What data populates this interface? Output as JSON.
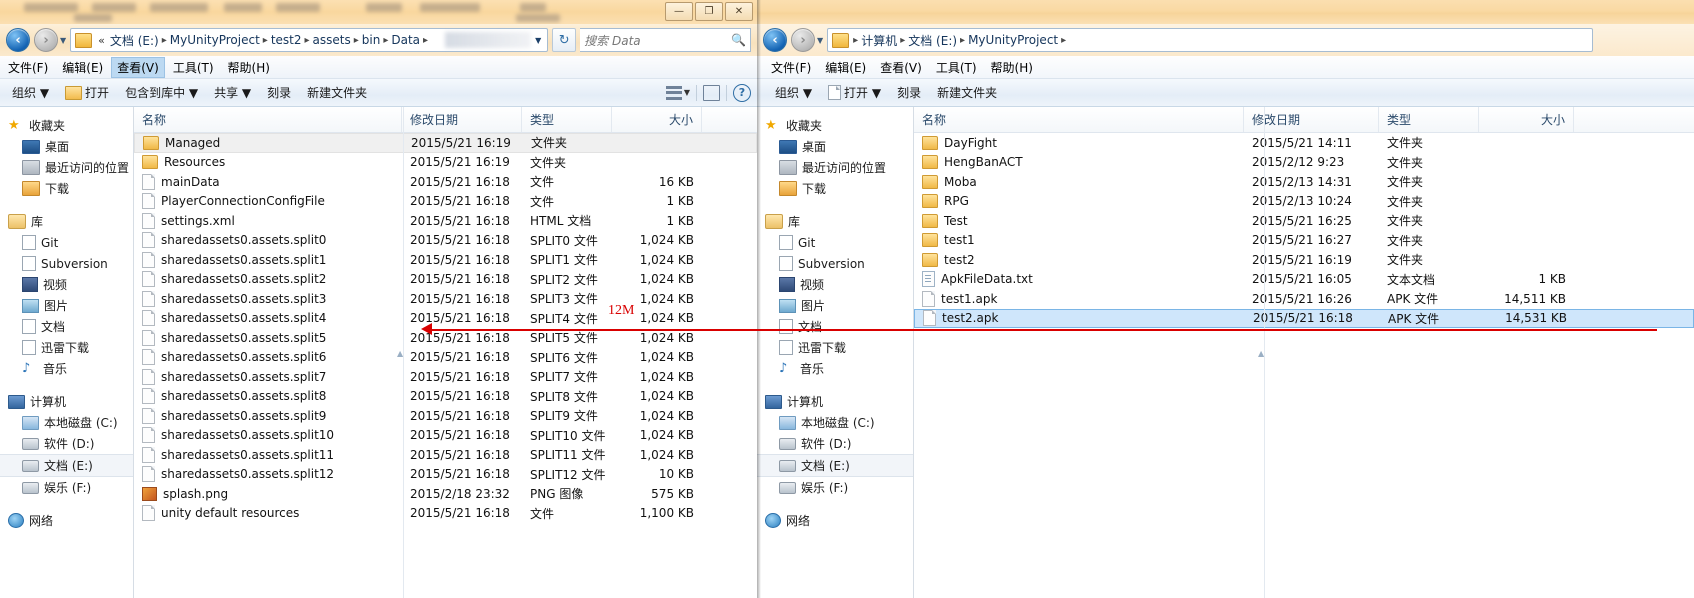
{
  "left_window": {
    "title_bar": {
      "minimize": "—",
      "maximize": "❐",
      "close": "✕"
    },
    "address": {
      "crumb_prefix": "«",
      "crumbs": [
        "文档 (E:)",
        "MyUnityProject",
        "test2",
        "assets",
        "bin",
        "Data"
      ],
      "separator": "▸",
      "dropdown": "▼",
      "refresh": "↻"
    },
    "search": {
      "placeholder": "搜索 Data",
      "icon": "search-icon"
    },
    "menu": [
      {
        "label": "文件(F)",
        "active": false
      },
      {
        "label": "编辑(E)",
        "active": false
      },
      {
        "label": "查看(V)",
        "active": true
      },
      {
        "label": "工具(T)",
        "active": false
      },
      {
        "label": "帮助(H)",
        "active": false
      }
    ],
    "commands": [
      {
        "label": "组织 ▼",
        "icon": "none"
      },
      {
        "label": "打开",
        "icon": "folder-icon"
      },
      {
        "label": "包含到库中 ▼",
        "icon": "none"
      },
      {
        "label": "共享 ▼",
        "icon": "none"
      },
      {
        "label": "刻录",
        "icon": "none"
      },
      {
        "label": "新建文件夹",
        "icon": "none"
      }
    ],
    "command_right": {
      "view_caret": "▼",
      "help": "?"
    },
    "nav_pane": [
      {
        "label": "收藏夹",
        "icon": "star-icon",
        "level": 0
      },
      {
        "label": "桌面",
        "icon": "desktop-icon",
        "level": 1
      },
      {
        "label": "最近访问的位置",
        "icon": "recent-icon",
        "level": 1
      },
      {
        "label": "下载",
        "icon": "download-icon",
        "level": 1
      },
      {
        "label": "__SPACE__",
        "icon": "",
        "level": 0
      },
      {
        "label": "库",
        "icon": "library-icon",
        "level": 0
      },
      {
        "label": "Git",
        "icon": "doc-icon",
        "level": 1
      },
      {
        "label": "Subversion",
        "icon": "doc-icon",
        "level": 1
      },
      {
        "label": "视频",
        "icon": "video-icon",
        "level": 1
      },
      {
        "label": "图片",
        "icon": "picture-icon",
        "level": 1
      },
      {
        "label": "文档",
        "icon": "doc-icon",
        "level": 1
      },
      {
        "label": "迅雷下载",
        "icon": "doc-icon",
        "level": 1
      },
      {
        "label": "音乐",
        "icon": "music-icon",
        "level": 1
      },
      {
        "label": "__SPACE__",
        "icon": "",
        "level": 0
      },
      {
        "label": "计算机",
        "icon": "computer-icon",
        "level": 0
      },
      {
        "label": "本地磁盘 (C:)",
        "icon": "hdd-c-icon",
        "level": 1
      },
      {
        "label": "软件 (D:)",
        "icon": "hdd-icon",
        "level": 1
      },
      {
        "label": "文档 (E:)",
        "icon": "hdd-icon",
        "level": 1,
        "selected": true
      },
      {
        "label": "娱乐 (F:)",
        "icon": "hdd-icon",
        "level": 1
      },
      {
        "label": "__SPACE__",
        "icon": "",
        "level": 0
      },
      {
        "label": "网络",
        "icon": "network-icon",
        "level": 0
      }
    ],
    "columns": [
      "名称",
      "修改日期",
      "类型",
      "大小"
    ],
    "files": [
      {
        "name": "Managed",
        "date": "2015/5/21 16:19",
        "type": "文件夹",
        "size": "",
        "icon": "folder",
        "selected_soft": true
      },
      {
        "name": "Resources",
        "date": "2015/5/21 16:19",
        "type": "文件夹",
        "size": "",
        "icon": "folder"
      },
      {
        "name": "mainData",
        "date": "2015/5/21 16:18",
        "type": "文件",
        "size": "16 KB",
        "icon": "file"
      },
      {
        "name": "PlayerConnectionConfigFile",
        "date": "2015/5/21 16:18",
        "type": "文件",
        "size": "1 KB",
        "icon": "file"
      },
      {
        "name": "settings.xml",
        "date": "2015/5/21 16:18",
        "type": "HTML 文档",
        "size": "1 KB",
        "icon": "file"
      },
      {
        "name": "sharedassets0.assets.split0",
        "date": "2015/5/21 16:18",
        "type": "SPLIT0 文件",
        "size": "1,024 KB",
        "icon": "file"
      },
      {
        "name": "sharedassets0.assets.split1",
        "date": "2015/5/21 16:18",
        "type": "SPLIT1 文件",
        "size": "1,024 KB",
        "icon": "file"
      },
      {
        "name": "sharedassets0.assets.split2",
        "date": "2015/5/21 16:18",
        "type": "SPLIT2 文件",
        "size": "1,024 KB",
        "icon": "file"
      },
      {
        "name": "sharedassets0.assets.split3",
        "date": "2015/5/21 16:18",
        "type": "SPLIT3 文件",
        "size": "1,024 KB",
        "icon": "file"
      },
      {
        "name": "sharedassets0.assets.split4",
        "date": "2015/5/21 16:18",
        "type": "SPLIT4 文件",
        "size": "1,024 KB",
        "icon": "file"
      },
      {
        "name": "sharedassets0.assets.split5",
        "date": "2015/5/21 16:18",
        "type": "SPLIT5 文件",
        "size": "1,024 KB",
        "icon": "file"
      },
      {
        "name": "sharedassets0.assets.split6",
        "date": "2015/5/21 16:18",
        "type": "SPLIT6 文件",
        "size": "1,024 KB",
        "icon": "file"
      },
      {
        "name": "sharedassets0.assets.split7",
        "date": "2015/5/21 16:18",
        "type": "SPLIT7 文件",
        "size": "1,024 KB",
        "icon": "file"
      },
      {
        "name": "sharedassets0.assets.split8",
        "date": "2015/5/21 16:18",
        "type": "SPLIT8 文件",
        "size": "1,024 KB",
        "icon": "file"
      },
      {
        "name": "sharedassets0.assets.split9",
        "date": "2015/5/21 16:18",
        "type": "SPLIT9 文件",
        "size": "1,024 KB",
        "icon": "file"
      },
      {
        "name": "sharedassets0.assets.split10",
        "date": "2015/5/21 16:18",
        "type": "SPLIT10 文件",
        "size": "1,024 KB",
        "icon": "file"
      },
      {
        "name": "sharedassets0.assets.split11",
        "date": "2015/5/21 16:18",
        "type": "SPLIT11 文件",
        "size": "1,024 KB",
        "icon": "file"
      },
      {
        "name": "sharedassets0.assets.split12",
        "date": "2015/5/21 16:18",
        "type": "SPLIT12 文件",
        "size": "10 KB",
        "icon": "file"
      },
      {
        "name": "splash.png",
        "date": "2015/2/18 23:32",
        "type": "PNG 图像",
        "size": "575 KB",
        "icon": "png"
      },
      {
        "name": "unity default resources",
        "date": "2015/5/21 16:18",
        "type": "文件",
        "size": "1,100 KB",
        "icon": "file"
      }
    ]
  },
  "right_window": {
    "address": {
      "crumbs": [
        "计算机",
        "文档 (E:)",
        "MyUnityProject"
      ],
      "separator": "▸"
    },
    "menu": [
      {
        "label": "文件(F)"
      },
      {
        "label": "编辑(E)"
      },
      {
        "label": "查看(V)"
      },
      {
        "label": "工具(T)"
      },
      {
        "label": "帮助(H)"
      }
    ],
    "commands": [
      {
        "label": "组织 ▼",
        "icon": "none"
      },
      {
        "label": "打开 ▼",
        "icon": "file-icon"
      },
      {
        "label": "刻录",
        "icon": "none"
      },
      {
        "label": "新建文件夹",
        "icon": "none"
      }
    ],
    "nav_pane": [
      {
        "label": "收藏夹",
        "icon": "star-icon",
        "level": 0
      },
      {
        "label": "桌面",
        "icon": "desktop-icon",
        "level": 1
      },
      {
        "label": "最近访问的位置",
        "icon": "recent-icon",
        "level": 1
      },
      {
        "label": "下载",
        "icon": "download-icon",
        "level": 1
      },
      {
        "label": "__SPACE__",
        "icon": "",
        "level": 0
      },
      {
        "label": "库",
        "icon": "library-icon",
        "level": 0
      },
      {
        "label": "Git",
        "icon": "doc-icon",
        "level": 1
      },
      {
        "label": "Subversion",
        "icon": "doc-icon",
        "level": 1
      },
      {
        "label": "视频",
        "icon": "video-icon",
        "level": 1
      },
      {
        "label": "图片",
        "icon": "picture-icon",
        "level": 1
      },
      {
        "label": "文档",
        "icon": "doc-icon",
        "level": 1
      },
      {
        "label": "迅雷下载",
        "icon": "doc-icon",
        "level": 1
      },
      {
        "label": "音乐",
        "icon": "music-icon",
        "level": 1
      },
      {
        "label": "__SPACE__",
        "icon": "",
        "level": 0
      },
      {
        "label": "计算机",
        "icon": "computer-icon",
        "level": 0
      },
      {
        "label": "本地磁盘 (C:)",
        "icon": "hdd-c-icon",
        "level": 1
      },
      {
        "label": "软件 (D:)",
        "icon": "hdd-icon",
        "level": 1
      },
      {
        "label": "文档 (E:)",
        "icon": "hdd-icon",
        "level": 1,
        "selected": true
      },
      {
        "label": "娱乐 (F:)",
        "icon": "hdd-icon",
        "level": 1
      },
      {
        "label": "__SPACE__",
        "icon": "",
        "level": 0
      },
      {
        "label": "网络",
        "icon": "network-icon",
        "level": 0
      }
    ],
    "columns": [
      "名称",
      "修改日期",
      "类型",
      "大小"
    ],
    "files": [
      {
        "name": "DayFight",
        "date": "2015/5/21 14:11",
        "type": "文件夹",
        "size": "",
        "icon": "folder"
      },
      {
        "name": "HengBanACT",
        "date": "2015/2/12 9:23",
        "type": "文件夹",
        "size": "",
        "icon": "folder"
      },
      {
        "name": "Moba",
        "date": "2015/2/13 14:31",
        "type": "文件夹",
        "size": "",
        "icon": "folder"
      },
      {
        "name": "RPG",
        "date": "2015/2/13 10:24",
        "type": "文件夹",
        "size": "",
        "icon": "folder"
      },
      {
        "name": "Test",
        "date": "2015/5/21 16:25",
        "type": "文件夹",
        "size": "",
        "icon": "folder"
      },
      {
        "name": "test1",
        "date": "2015/5/21 16:27",
        "type": "文件夹",
        "size": "",
        "icon": "folder"
      },
      {
        "name": "test2",
        "date": "2015/5/21 16:19",
        "type": "文件夹",
        "size": "",
        "icon": "folder"
      },
      {
        "name": "ApkFileData.txt",
        "date": "2015/5/21 16:05",
        "type": "文本文档",
        "size": "1 KB",
        "icon": "txt"
      },
      {
        "name": "test1.apk",
        "date": "2015/5/21 16:26",
        "type": "APK 文件",
        "size": "14,511 KB",
        "icon": "file"
      },
      {
        "name": "test2.apk",
        "date": "2015/5/21 16:18",
        "type": "APK 文件",
        "size": "14,531 KB",
        "icon": "file",
        "selected": true
      }
    ]
  },
  "annotation": {
    "label": "12M",
    "color": "#d90000"
  }
}
